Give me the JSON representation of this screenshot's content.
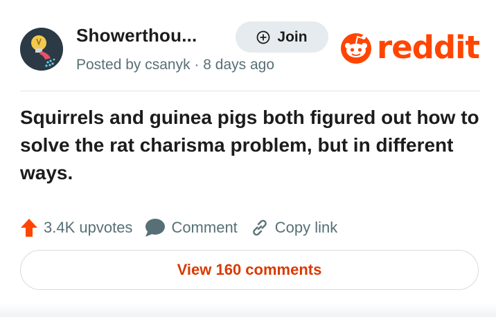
{
  "header": {
    "community_name": "Showerthou...",
    "posted_by": "Posted by csanyk · 8 days ago",
    "join_label": "Join",
    "brand_word": "reddit",
    "avatar_icon": "shower-lightbulb-icon"
  },
  "post": {
    "title": "Squirrels and guinea pigs both figured out how to solve the rat charisma problem, but in different ways."
  },
  "actions": {
    "upvotes_label": "3.4K upvotes",
    "comment_label": "Comment",
    "copy_link_label": "Copy link"
  },
  "footer": {
    "view_comments_label": "View 160 comments"
  },
  "colors": {
    "brand": "#ff4500",
    "link": "#d93a00",
    "muted": "#576f76",
    "join_bg": "#e5ebee"
  }
}
